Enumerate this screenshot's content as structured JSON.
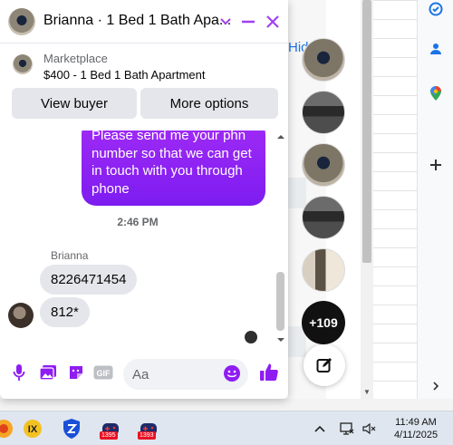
{
  "chat": {
    "title": "Brianna · 1 Bed 1 Bath Apa...",
    "marketplace_label": "Marketplace",
    "listing_title": "$400 - 1 Bed 1 Bath Apartment",
    "view_buyer_label": "View buyer",
    "more_options_label": "More options",
    "outgoing_message": "Please send me your phn number so that we can get in touch with you through phone",
    "timestamp": "2:46 PM",
    "sender_name": "Brianna",
    "incoming_messages": [
      "8226471454",
      "812*"
    ],
    "composer_placeholder": "Aa",
    "accent_color": "#8e1df2"
  },
  "background": {
    "link_text": "Hid"
  },
  "chat_heads": {
    "more_count": "+109"
  },
  "taskbar": {
    "badges": [
      "1395",
      "1393"
    ],
    "time": "11:49 AM",
    "date": "4/11/2025"
  }
}
